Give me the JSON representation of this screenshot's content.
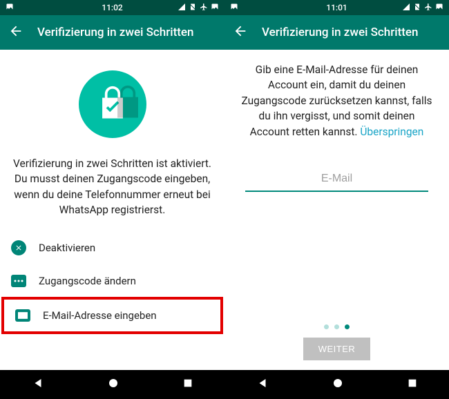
{
  "left": {
    "status": {
      "time": "11:02"
    },
    "appbar": {
      "title": "Verifizierung in zwei Schritten"
    },
    "description": "Verifizierung in zwei Schritten ist aktiviert. Du musst deinen Zugangscode eingeben, wenn du deine Telefonnummer erneut bei WhatsApp registrierst.",
    "options": {
      "deactivate": "Deaktivieren",
      "change_code": "Zugangscode ändern",
      "enter_email": "E-Mail-Adresse eingeben"
    }
  },
  "right": {
    "status": {
      "time": "11:01"
    },
    "appbar": {
      "title": "Verifizierung in zwei Schritten"
    },
    "instructions_main": "Gib eine E-Mail-Adresse für deinen Account ein, damit du deinen Zugangscode zurücksetzen kannst, falls du ihn vergisst, und somit deinen Account retten kannst. ",
    "skip_label": "Überspringen",
    "email_placeholder": "E-Mail",
    "next_label": "WEITER"
  },
  "colors": {
    "primary": "#00796b",
    "accent": "#00bfa5",
    "highlight": "#e30000"
  }
}
